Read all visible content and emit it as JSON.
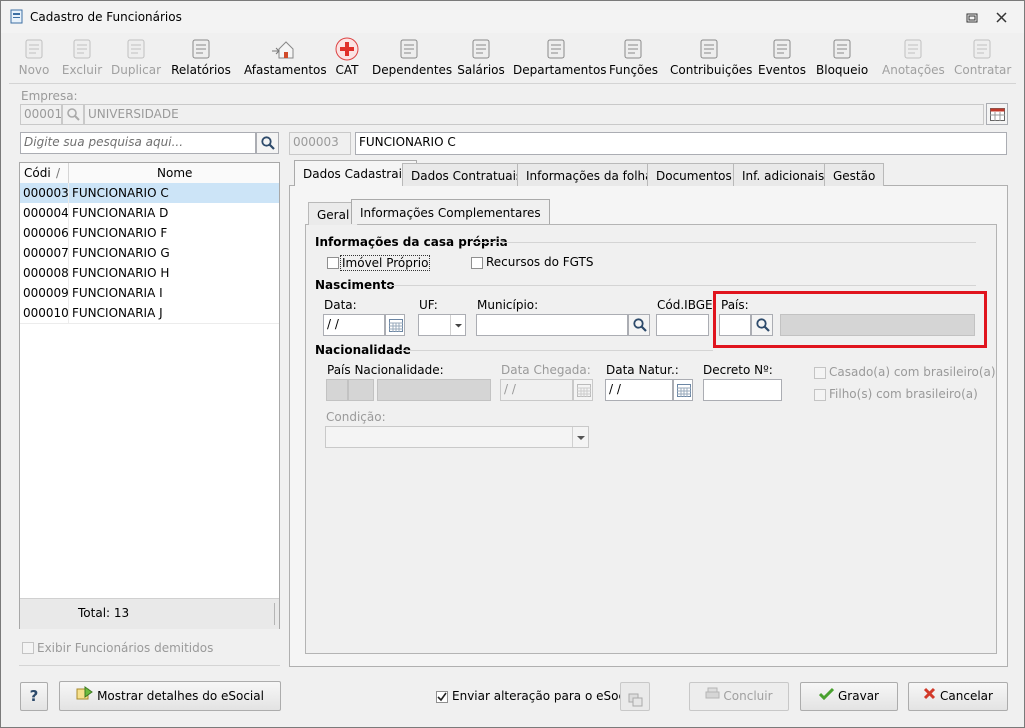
{
  "window": {
    "title": "Cadastro de Funcionários"
  },
  "toolbar": [
    {
      "label": "Novo",
      "icon": "new-doc-icon",
      "enabled": false
    },
    {
      "label": "Excluir",
      "icon": "trash-icon",
      "enabled": false
    },
    {
      "label": "Duplicar",
      "icon": "duplicate-users-icon",
      "enabled": false
    },
    {
      "label": "Relatórios",
      "icon": "report-icon",
      "enabled": true
    },
    {
      "label": "Afastamentos",
      "icon": "house-arrow-icon",
      "enabled": true
    },
    {
      "label": "CAT",
      "icon": "red-cross-icon",
      "enabled": true
    },
    {
      "label": "Dependentes",
      "icon": "users-icon",
      "enabled": true
    },
    {
      "label": "Salários",
      "icon": "money-icon",
      "enabled": true
    },
    {
      "label": "Departamentos",
      "icon": "desk-icon",
      "enabled": true
    },
    {
      "label": "Funções",
      "icon": "badge-icon",
      "enabled": true
    },
    {
      "label": "Contribuições",
      "icon": "group-icon",
      "enabled": true
    },
    {
      "label": "Eventos",
      "icon": "list-icon",
      "enabled": true
    },
    {
      "label": "Bloqueio",
      "icon": "lock-icon",
      "enabled": true
    },
    {
      "label": "Anotações",
      "icon": "note-check-icon",
      "enabled": false
    },
    {
      "label": "Contratar",
      "icon": "contract-icon",
      "enabled": false
    }
  ],
  "empresa": {
    "label": "Empresa:",
    "code": "00001",
    "name": "UNIVERSIDADE"
  },
  "search": {
    "placeholder": "Digite sua pesquisa aqui..."
  },
  "employee": {
    "code": "000003",
    "name": "FUNCIONARIO C"
  },
  "grid": {
    "headers": [
      "Códi",
      "Nome"
    ],
    "rows": [
      {
        "code": "000003",
        "name": "FUNCIONARIO C"
      },
      {
        "code": "000004",
        "name": "FUNCIONARIA D"
      },
      {
        "code": "000006",
        "name": "FUNCIONARIO F"
      },
      {
        "code": "000007",
        "name": "FUNCIONARIO G"
      },
      {
        "code": "000008",
        "name": "FUNCIONARIO H"
      },
      {
        "code": "000009",
        "name": "FUNCIONARIA I"
      },
      {
        "code": "000010",
        "name": "FUNCIONARIA J"
      }
    ],
    "total": "Total: 13"
  },
  "show_dismissed": "Exibir Funcionários demitidos",
  "tabs": [
    "Dados Cadastrais",
    "Dados Contratuais",
    "Informações da folha",
    "Documentos",
    "Inf. adicionais",
    "Gestão"
  ],
  "subtabs": [
    "Geral",
    "Informações Complementares"
  ],
  "casa_propria": {
    "title": "Informações da casa própria",
    "imovel": "Imóvel Próprio",
    "fgts": "Recursos do FGTS"
  },
  "nascimento": {
    "title": "Nascimento",
    "data_label": "Data:",
    "data_value": " / /",
    "uf_label": "UF:",
    "municipio_label": "Município:",
    "ibge_label": "Cód.IBGE:",
    "pais_label": "País:"
  },
  "nacionalidade": {
    "title": "Nacionalidade",
    "pais_label": "País Nacionalidade:",
    "chegada_label": "Data Chegada:",
    "chegada_value": " / /",
    "natur_label": "Data Natur.:",
    "natur_value": " / /",
    "decreto_label": "Decreto Nº:",
    "casado": "Casado(a) com brasileiro(a)",
    "filhos": "Filho(s) com brasileiro(a)",
    "condicao_label": "Condição:"
  },
  "footer": {
    "help": "?",
    "esocial_details": "Mostrar detalhes do eSocial",
    "send_change": "Enviar alteração para o eSocial",
    "concluir": "Concluir",
    "gravar": "Gravar",
    "cancelar": "Cancelar"
  },
  "colors": {
    "highlight": "#e0141e",
    "selected_row": "#cce4f7",
    "disabled_text": "#a0a0a0"
  }
}
